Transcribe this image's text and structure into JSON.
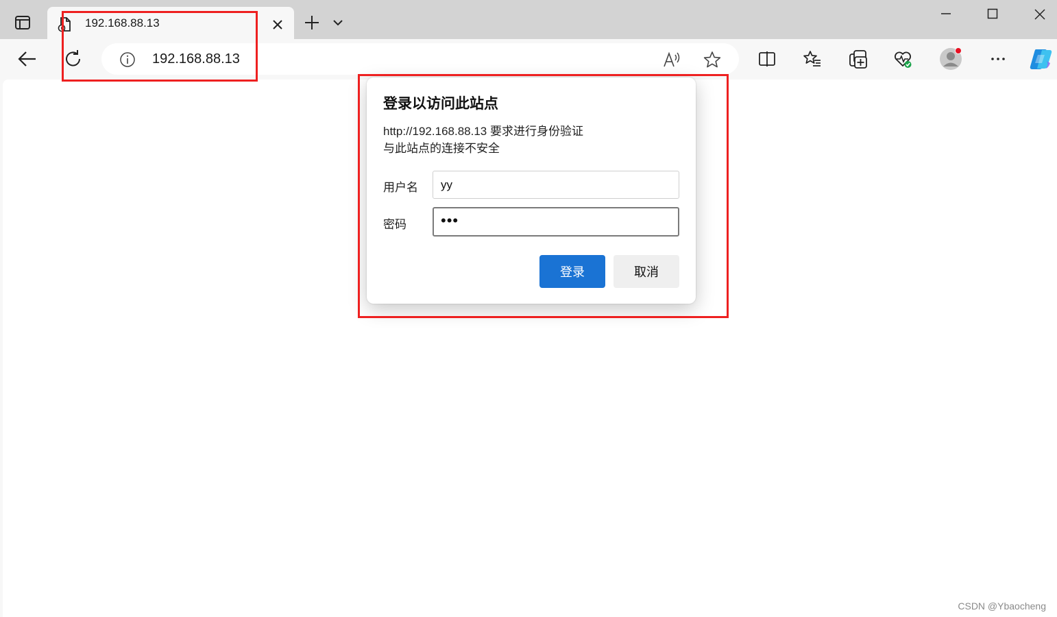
{
  "tab": {
    "title": "192.168.88.13"
  },
  "toolbar": {
    "url": "192.168.88.13"
  },
  "dialog": {
    "title": "登录以访问此站点",
    "message_line1": "http://192.168.88.13 要求进行身份验证",
    "message_line2": "与此站点的连接不安全",
    "username_label": "用户名",
    "username_value": "yy",
    "password_label": "密码",
    "password_value": "•••",
    "login_label": "登录",
    "cancel_label": "取消"
  },
  "watermark": "CSDN @Ybaocheng",
  "colors": {
    "accent": "#1a73d4",
    "annotation": "#ee2020",
    "titlebar": "#d3d3d3"
  },
  "icons": {
    "tab_actions": "tab-actions-icon",
    "favicon": "page-file-icon",
    "back": "arrow-left-icon",
    "refresh": "refresh-icon",
    "info": "info-icon",
    "read_aloud": "read-aloud-icon",
    "favorite": "star-icon",
    "split_screen": "split-screen-icon",
    "favorites": "favorites-icon",
    "collections": "collections-icon",
    "browser_essentials": "heart-pulse-icon",
    "profile": "avatar-icon",
    "more": "ellipsis-icon",
    "copilot": "copilot-icon"
  }
}
